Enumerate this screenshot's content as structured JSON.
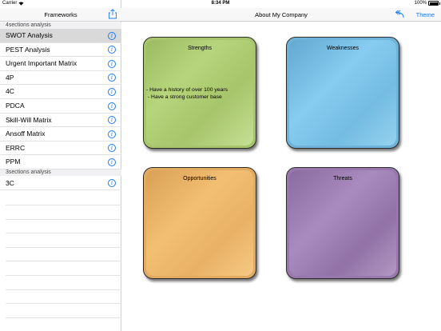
{
  "status_bar": {
    "carrier": "Carrier",
    "time": "8:34 PM",
    "battery": "100%"
  },
  "sidebar": {
    "title": "Frameworks",
    "sections": [
      {
        "header": "4sections analysis",
        "items": [
          {
            "label": "SWOT Analysis",
            "selected": true
          },
          {
            "label": "PEST Analysis"
          },
          {
            "label": "Urgent Important Matrix"
          },
          {
            "label": "4P"
          },
          {
            "label": "4C"
          },
          {
            "label": "PDCA"
          },
          {
            "label": "Skill-Will Matrix"
          },
          {
            "label": "Ansoff Matrix"
          },
          {
            "label": "ERRC"
          },
          {
            "label": "PPM"
          }
        ]
      },
      {
        "header": "3sections analysis",
        "items": [
          {
            "label": "3C"
          }
        ]
      }
    ],
    "info_glyph": "i"
  },
  "main": {
    "title": "About My Company",
    "theme_label": "Theme",
    "undo_icon": "undo-arrow-icon",
    "cards": [
      {
        "title": "Strengths",
        "body": "- Have a history of over 100 years\n - Have a strong customer base",
        "color": "#a6c56c"
      },
      {
        "title": "Weaknesses",
        "body": "",
        "color": "#74bce2"
      },
      {
        "title": "Opportunities",
        "body": "",
        "color": "#eab366"
      },
      {
        "title": "Threats",
        "body": "",
        "color": "#9a7aae"
      }
    ]
  },
  "colors": {
    "accent": "#1f7cf6",
    "selected_row": "#d9d9d9"
  }
}
